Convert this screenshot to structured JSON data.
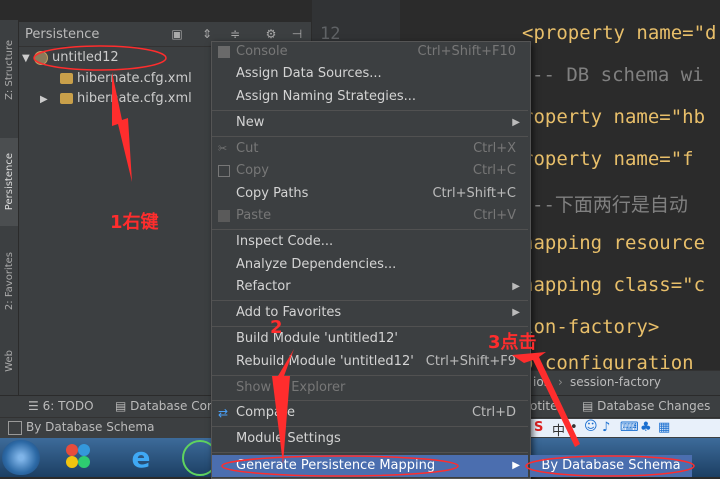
{
  "toolstrip": {
    "structure_label": "Z: Structure",
    "persistence_label": "Persistence",
    "favorites_label": "2: Favorites",
    "web_label": "Web"
  },
  "panel": {
    "title": "Persistence",
    "tree": [
      {
        "label": "untitled12",
        "expanded": true
      },
      {
        "label": "hibernate.cfg.xml"
      },
      {
        "label": "hibernate.cfg.xml",
        "expanded": false
      }
    ]
  },
  "editor": {
    "line_number": "12",
    "lines": [
      {
        "tag": "<property name=\"d",
        "kind": "code"
      },
      {
        "text": "-- DB schema wi",
        "kind": "comment"
      },
      {
        "tag": "roperty name=\"hb",
        "kind": "code"
      },
      {
        "tag": "roperty name=\"f",
        "kind": "code"
      },
      {
        "text": "--下面两行是自动",
        "kind": "comment"
      },
      {
        "tag": "napping resource",
        "kind": "code"
      },
      {
        "tag": "napping class=\"c",
        "kind": "code"
      },
      {
        "tag": "ion-factory>",
        "kind": "code"
      },
      {
        "tag": "o-configuration",
        "kind": "code"
      }
    ],
    "breadcrumb": [
      "ion",
      "session-factory"
    ]
  },
  "context_menu": {
    "items": [
      {
        "label": "Console",
        "shortcut": "Ctrl+Shift+F10",
        "disabled": true
      },
      {
        "label": "Assign Data Sources..."
      },
      {
        "label": "Assign Naming Strategies..."
      },
      {
        "label": "New",
        "submenu": true
      },
      {
        "label": "Cut",
        "shortcut": "Ctrl+X",
        "disabled": true
      },
      {
        "label": "Copy",
        "shortcut": "Ctrl+C",
        "disabled": true
      },
      {
        "label": "Copy Paths",
        "shortcut": "Ctrl+Shift+C"
      },
      {
        "label": "Paste",
        "shortcut": "Ctrl+V",
        "disabled": true
      },
      {
        "label": "Inspect Code..."
      },
      {
        "label": "Analyze Dependencies..."
      },
      {
        "label": "Refactor",
        "submenu": true
      },
      {
        "label": "Add to Favorites",
        "submenu": true
      },
      {
        "label": "Build Module 'untitled12'"
      },
      {
        "label": "Rebuild Module 'untitled12'",
        "shortcut": "Ctrl+Shift+F9"
      },
      {
        "label": "Show in Explorer",
        "disabled": true
      },
      {
        "label": "Compare",
        "shortcut": "Ctrl+D"
      },
      {
        "label": "Module Settings"
      },
      {
        "label": "Generate Persistence Mapping",
        "submenu": true,
        "selected": true
      }
    ],
    "submenu_item": "By Database Schema"
  },
  "bottom_tools": {
    "todo": "6: TODO",
    "database_console": "Database Cons",
    "database_changes": "Database Changes",
    "partial": "otite"
  },
  "status": {
    "text": "By Database Schema"
  },
  "annotations": {
    "step1": "1右键",
    "step2": "2",
    "step3": "3点击"
  },
  "colors": {
    "accent_selection": "#4b6eaf",
    "annotation_red": "#ff2d2d"
  }
}
